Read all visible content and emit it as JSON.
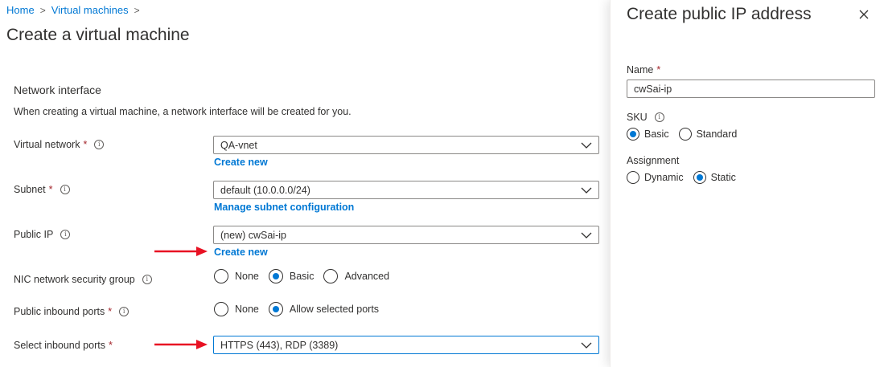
{
  "breadcrumb": {
    "home": "Home",
    "separator": ">",
    "vms": "Virtual machines"
  },
  "page_title": "Create a virtual machine",
  "network": {
    "section_title": "Network interface",
    "description": "When creating a virtual machine, a network interface will be created for you.",
    "required_marker": "*",
    "info_glyph": "i",
    "virtual_network": {
      "label": "Virtual network",
      "value": "QA-vnet",
      "link": "Create new"
    },
    "subnet": {
      "label": "Subnet",
      "value": "default (10.0.0.0/24)",
      "link": "Manage subnet configuration"
    },
    "public_ip": {
      "label": "Public IP",
      "value": "(new) cwSai-ip",
      "link": "Create new"
    },
    "nic_nsg": {
      "label": "NIC network security group",
      "options": [
        "None",
        "Basic",
        "Advanced"
      ],
      "selected": "Basic"
    },
    "public_inbound": {
      "label": "Public inbound ports",
      "options": [
        "None",
        "Allow selected ports"
      ],
      "selected": "Allow selected ports"
    },
    "select_inbound": {
      "label": "Select inbound ports",
      "value": "HTTPS (443), RDP (3389)"
    }
  },
  "panel": {
    "title": "Create public IP address",
    "name": {
      "label": "Name",
      "value": "cwSai-ip"
    },
    "sku": {
      "label": "SKU",
      "options": [
        "Basic",
        "Standard"
      ],
      "selected": "Basic"
    },
    "assignment": {
      "label": "Assignment",
      "options": [
        "Dynamic",
        "Static"
      ],
      "selected": "Static"
    }
  },
  "colors": {
    "accent": "#0078d4",
    "required": "#a4262c",
    "arrow": "#e81123"
  },
  "icons": {
    "chevron": "chevron-down-icon",
    "info": "info-icon",
    "close": "close-icon",
    "arrow": "red-arrow-icon"
  }
}
